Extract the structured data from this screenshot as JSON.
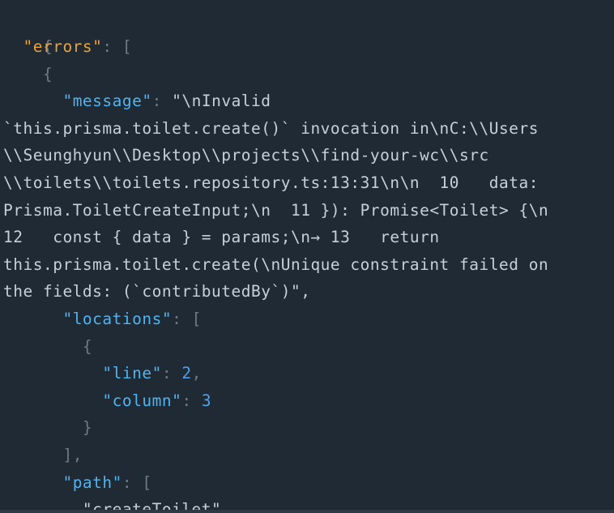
{
  "json_view": {
    "open_brace": "{",
    "errors_key": "\"errors\"",
    "colon": ":",
    "open_bracket": "[",
    "obj_open": "{",
    "message_key": "\"message\"",
    "message_lines": [
      "\"\\nInvalid",
      "`this.prisma.toilet.create()` invocation in\\nC:\\\\Users",
      "\\\\Seunghyun\\\\Desktop\\\\projects\\\\find-your-wc\\\\src",
      "\\\\toilets\\\\toilets.repository.ts:13:31\\n\\n  10   data:",
      "Prisma.ToiletCreateInput;\\n  11 }): Promise<Toilet> {\\n",
      "12   const { data } = params;\\n→ 13   return",
      "this.prisma.toilet.create(\\nUnique constraint failed on",
      "the fields: (`contributedBy`)\","
    ],
    "locations_key": "\"locations\"",
    "loc_open": "{",
    "line_key": "\"line\"",
    "line_value": "2",
    "comma": ",",
    "column_key": "\"column\"",
    "column_value": "3",
    "loc_close": "}",
    "locations_close": "],",
    "path_key": "\"path\"",
    "path_first": "\"createToilet\","
  }
}
